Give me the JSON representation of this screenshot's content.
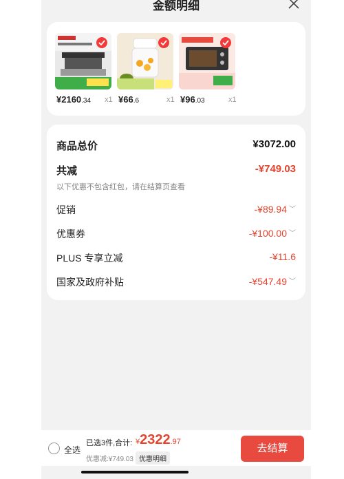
{
  "header": {
    "title": "金额明细",
    "close_icon": "close-icon"
  },
  "products": [
    {
      "price_int": "¥2160",
      "price_dec": ".34",
      "qty": "x1",
      "image": "range-hood-product",
      "checked": true
    },
    {
      "price_int": "¥66",
      "price_dec": ".6",
      "qty": "x1",
      "image": "food-chopper-product",
      "checked": true
    },
    {
      "price_int": "¥96",
      "price_dec": ".03",
      "qty": "x1",
      "image": "toaster-oven-product",
      "checked": true
    }
  ],
  "summary": {
    "total_label": "商品总价",
    "total_value": "¥3072.00",
    "reduce_label": "共减",
    "reduce_value": "-¥749.03",
    "note": "以下优惠不包含红包，请在结算页查看",
    "items": [
      {
        "label": "促销",
        "value": "-¥89.94",
        "expandable": true
      },
      {
        "label": "优惠券",
        "value": "-¥100.00",
        "expandable": true
      },
      {
        "label": "PLUS 专享立减",
        "value": "-¥11.6",
        "expandable": false
      },
      {
        "label": "国家及政府补贴",
        "value": "-¥547.49",
        "expandable": true
      }
    ]
  },
  "bottom": {
    "select_all": "全选",
    "selected_text": "已选3件,合计:",
    "total_symbol": "¥",
    "total_int": "2322",
    "total_dec": ".97",
    "discount_text": "优惠减:¥749.03",
    "detail_button": "优惠明细",
    "checkout_button": "去结算"
  },
  "colors": {
    "accent": "#e5442f",
    "checkout_bg": "#e84a3f",
    "panel_bg": "#f2f2f2"
  }
}
